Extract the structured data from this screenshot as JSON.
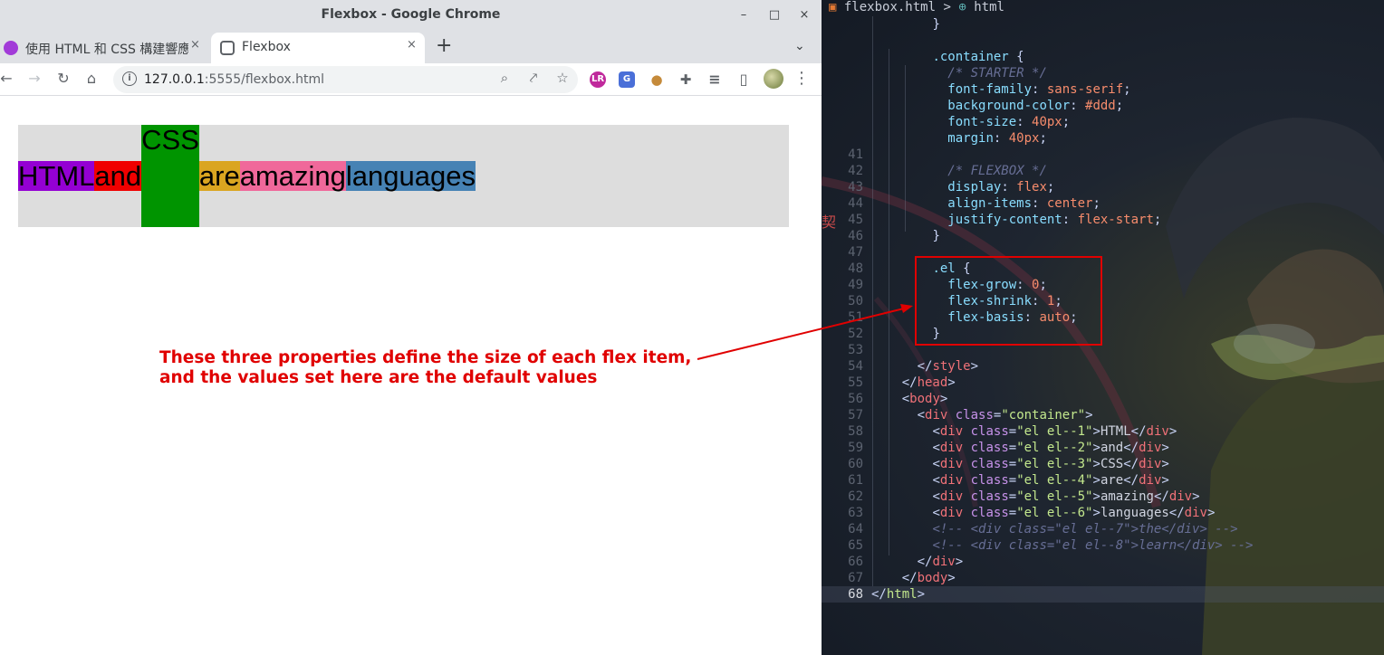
{
  "window": {
    "title": "Flexbox - Google Chrome",
    "controls": [
      "–",
      "□",
      "×"
    ]
  },
  "tabs": [
    {
      "label": "使用 HTML 和 CSS 構建響應",
      "favicon_color": "#a23bd8"
    },
    {
      "label": "Flexbox",
      "active": true
    }
  ],
  "tab_close": "×",
  "new_tab": "+",
  "tab_menu": "⌄",
  "nav": {
    "back": "←",
    "forward": "→",
    "reload": "↻",
    "home": "⌂"
  },
  "address": {
    "host": "127.0.0.1",
    "rest": ":5555/flexbox.html",
    "info": "i"
  },
  "omni_icons": {
    "zoom": "⌕",
    "share": "⤤",
    "bookmark": "☆"
  },
  "extensions": [
    {
      "name": "lr-icon",
      "glyph": "LR",
      "color": "#c0299c"
    },
    {
      "name": "translate-icon",
      "glyph": "G",
      "color": "#4a6fd8"
    },
    {
      "name": "cookie-icon",
      "glyph": "●",
      "color": "#c58a3a"
    },
    {
      "name": "puzzle-icon",
      "glyph": "✚",
      "color": "#5f6368"
    },
    {
      "name": "playlist-icon",
      "glyph": "≡",
      "color": "#5f6368"
    },
    {
      "name": "sidepanel-icon",
      "glyph": "▯",
      "color": "#5f6368"
    }
  ],
  "menu": "⋮",
  "flex_items": [
    {
      "text": "HTML",
      "color": "#9400d3"
    },
    {
      "text": "and",
      "color": "#f00000"
    },
    {
      "text": "CSS",
      "color": "#009400"
    },
    {
      "text": "are",
      "color": "#daa520"
    },
    {
      "text": "amazing",
      "color": "#f0689a"
    },
    {
      "text": "languages",
      "color": "#4682b4"
    }
  ],
  "annotation": {
    "line1": "These three properties define the size of each flex item,",
    "line2": "and the values set here are the default values",
    "color": "#e00000"
  },
  "editor": {
    "breadcrumb": {
      "file": "flexbox.html",
      "sep": ">",
      "node": "html"
    },
    "side_char": "契",
    "lines": [
      {
        "n": "",
        "segs": [
          [
            "        ",
            ""
          ],
          [
            "}",
            "t-pun"
          ]
        ]
      },
      {
        "n": "",
        "segs": []
      },
      {
        "n": "",
        "segs": [
          [
            "        ",
            ""
          ],
          [
            ".container",
            "t-sel"
          ],
          [
            " {",
            "t-pun"
          ]
        ]
      },
      {
        "n": "",
        "segs": [
          [
            "          ",
            ""
          ],
          [
            "/* STARTER */",
            "t-com"
          ]
        ]
      },
      {
        "n": "",
        "segs": [
          [
            "          ",
            ""
          ],
          [
            "font-family",
            "t-prop"
          ],
          [
            ": ",
            "t-pun"
          ],
          [
            "sans-serif",
            "t-val"
          ],
          [
            ";",
            "t-pun"
          ]
        ]
      },
      {
        "n": "",
        "segs": [
          [
            "          ",
            ""
          ],
          [
            "background-color",
            "t-prop"
          ],
          [
            ": ",
            "t-pun"
          ],
          [
            "#ddd",
            "t-val"
          ],
          [
            ";",
            "t-pun"
          ]
        ]
      },
      {
        "n": "",
        "segs": [
          [
            "          ",
            ""
          ],
          [
            "font-size",
            "t-prop"
          ],
          [
            ": ",
            "t-pun"
          ],
          [
            "40px",
            "t-val"
          ],
          [
            ";",
            "t-pun"
          ]
        ]
      },
      {
        "n": "",
        "segs": [
          [
            "          ",
            ""
          ],
          [
            "margin",
            "t-prop"
          ],
          [
            ": ",
            "t-pun"
          ],
          [
            "40px",
            "t-val"
          ],
          [
            ";",
            "t-pun"
          ]
        ]
      },
      {
        "n": "41",
        "segs": []
      },
      {
        "n": "42",
        "segs": [
          [
            "          ",
            ""
          ],
          [
            "/* FLEXBOX */",
            "t-com"
          ]
        ]
      },
      {
        "n": "43",
        "segs": [
          [
            "          ",
            ""
          ],
          [
            "display",
            "t-prop"
          ],
          [
            ": ",
            "t-pun"
          ],
          [
            "flex",
            "t-val"
          ],
          [
            ";",
            "t-pun"
          ]
        ]
      },
      {
        "n": "44",
        "segs": [
          [
            "          ",
            ""
          ],
          [
            "align-items",
            "t-prop"
          ],
          [
            ": ",
            "t-pun"
          ],
          [
            "center",
            "t-val"
          ],
          [
            ";",
            "t-pun"
          ]
        ]
      },
      {
        "n": "45",
        "segs": [
          [
            "          ",
            ""
          ],
          [
            "justify-content",
            "t-prop"
          ],
          [
            ": ",
            "t-pun"
          ],
          [
            "flex-start",
            "t-val"
          ],
          [
            ";",
            "t-pun"
          ]
        ]
      },
      {
        "n": "46",
        "segs": [
          [
            "        ",
            ""
          ],
          [
            "}",
            "t-pun"
          ]
        ]
      },
      {
        "n": "47",
        "segs": []
      },
      {
        "n": "48",
        "segs": [
          [
            "        ",
            ""
          ],
          [
            ".el",
            "t-sel"
          ],
          [
            " {",
            "t-pun"
          ]
        ]
      },
      {
        "n": "49",
        "segs": [
          [
            "          ",
            ""
          ],
          [
            "flex-grow",
            "t-prop"
          ],
          [
            ": ",
            "t-pun"
          ],
          [
            "0",
            "t-val"
          ],
          [
            ";",
            "t-pun"
          ]
        ]
      },
      {
        "n": "50",
        "segs": [
          [
            "          ",
            ""
          ],
          [
            "flex-shrink",
            "t-prop"
          ],
          [
            ": ",
            "t-pun"
          ],
          [
            "1",
            "t-val"
          ],
          [
            ";",
            "t-pun"
          ]
        ]
      },
      {
        "n": "51",
        "segs": [
          [
            "          ",
            ""
          ],
          [
            "flex-basis",
            "t-prop"
          ],
          [
            ": ",
            "t-pun"
          ],
          [
            "auto",
            "t-val"
          ],
          [
            ";",
            "t-pun"
          ]
        ]
      },
      {
        "n": "52",
        "segs": [
          [
            "        ",
            ""
          ],
          [
            "}",
            "t-pun"
          ]
        ]
      },
      {
        "n": "53",
        "segs": []
      },
      {
        "n": "54",
        "segs": [
          [
            "      ",
            ""
          ],
          [
            "</",
            "t-pun"
          ],
          [
            "style",
            "t-tag"
          ],
          [
            ">",
            "t-pun"
          ]
        ]
      },
      {
        "n": "55",
        "segs": [
          [
            "    ",
            ""
          ],
          [
            "</",
            "t-pun"
          ],
          [
            "head",
            "t-tag"
          ],
          [
            ">",
            "t-pun"
          ]
        ]
      },
      {
        "n": "56",
        "segs": [
          [
            "    ",
            ""
          ],
          [
            "<",
            "t-pun"
          ],
          [
            "body",
            "t-tag"
          ],
          [
            ">",
            "t-pun"
          ]
        ]
      },
      {
        "n": "57",
        "segs": [
          [
            "      ",
            ""
          ],
          [
            "<",
            "t-pun"
          ],
          [
            "div",
            "t-tag"
          ],
          [
            " ",
            ""
          ],
          [
            "class",
            "t-attr"
          ],
          [
            "=",
            "t-pun"
          ],
          [
            "\"container\"",
            "t-str"
          ],
          [
            ">",
            "t-pun"
          ]
        ]
      },
      {
        "n": "58",
        "segs": [
          [
            "        ",
            ""
          ],
          [
            "<",
            "t-pun"
          ],
          [
            "div",
            "t-tag"
          ],
          [
            " ",
            ""
          ],
          [
            "class",
            "t-attr"
          ],
          [
            "=",
            "t-pun"
          ],
          [
            "\"el el--1\"",
            "t-str"
          ],
          [
            ">",
            "t-pun"
          ],
          [
            "HTML",
            "t-txt"
          ],
          [
            "</",
            "t-pun"
          ],
          [
            "div",
            "t-tag"
          ],
          [
            ">",
            "t-pun"
          ]
        ]
      },
      {
        "n": "59",
        "segs": [
          [
            "        ",
            ""
          ],
          [
            "<",
            "t-pun"
          ],
          [
            "div",
            "t-tag"
          ],
          [
            " ",
            ""
          ],
          [
            "class",
            "t-attr"
          ],
          [
            "=",
            "t-pun"
          ],
          [
            "\"el el--2\"",
            "t-str"
          ],
          [
            ">",
            "t-pun"
          ],
          [
            "and",
            "t-txt"
          ],
          [
            "</",
            "t-pun"
          ],
          [
            "div",
            "t-tag"
          ],
          [
            ">",
            "t-pun"
          ]
        ]
      },
      {
        "n": "60",
        "segs": [
          [
            "        ",
            ""
          ],
          [
            "<",
            "t-pun"
          ],
          [
            "div",
            "t-tag"
          ],
          [
            " ",
            ""
          ],
          [
            "class",
            "t-attr"
          ],
          [
            "=",
            "t-pun"
          ],
          [
            "\"el el--3\"",
            "t-str"
          ],
          [
            ">",
            "t-pun"
          ],
          [
            "CSS",
            "t-txt"
          ],
          [
            "</",
            "t-pun"
          ],
          [
            "div",
            "t-tag"
          ],
          [
            ">",
            "t-pun"
          ]
        ]
      },
      {
        "n": "61",
        "segs": [
          [
            "        ",
            ""
          ],
          [
            "<",
            "t-pun"
          ],
          [
            "div",
            "t-tag"
          ],
          [
            " ",
            ""
          ],
          [
            "class",
            "t-attr"
          ],
          [
            "=",
            "t-pun"
          ],
          [
            "\"el el--4\"",
            "t-str"
          ],
          [
            ">",
            "t-pun"
          ],
          [
            "are",
            "t-txt"
          ],
          [
            "</",
            "t-pun"
          ],
          [
            "div",
            "t-tag"
          ],
          [
            ">",
            "t-pun"
          ]
        ]
      },
      {
        "n": "62",
        "segs": [
          [
            "        ",
            ""
          ],
          [
            "<",
            "t-pun"
          ],
          [
            "div",
            "t-tag"
          ],
          [
            " ",
            ""
          ],
          [
            "class",
            "t-attr"
          ],
          [
            "=",
            "t-pun"
          ],
          [
            "\"el el--5\"",
            "t-str"
          ],
          [
            ">",
            "t-pun"
          ],
          [
            "amazing",
            "t-txt"
          ],
          [
            "</",
            "t-pun"
          ],
          [
            "div",
            "t-tag"
          ],
          [
            ">",
            "t-pun"
          ]
        ]
      },
      {
        "n": "63",
        "segs": [
          [
            "        ",
            ""
          ],
          [
            "<",
            "t-pun"
          ],
          [
            "div",
            "t-tag"
          ],
          [
            " ",
            ""
          ],
          [
            "class",
            "t-attr"
          ],
          [
            "=",
            "t-pun"
          ],
          [
            "\"el el--6\"",
            "t-str"
          ],
          [
            ">",
            "t-pun"
          ],
          [
            "languages",
            "t-txt"
          ],
          [
            "</",
            "t-pun"
          ],
          [
            "div",
            "t-tag"
          ],
          [
            ">",
            "t-pun"
          ]
        ]
      },
      {
        "n": "64",
        "segs": [
          [
            "        ",
            ""
          ],
          [
            "<!-- <div class=\"el el--7\">the</div> -->",
            "t-com"
          ]
        ]
      },
      {
        "n": "65",
        "segs": [
          [
            "        ",
            ""
          ],
          [
            "<!-- <div class=\"el el--8\">learn</div> -->",
            "t-com"
          ]
        ]
      },
      {
        "n": "66",
        "segs": [
          [
            "      ",
            ""
          ],
          [
            "</",
            "t-pun"
          ],
          [
            "div",
            "t-tag"
          ],
          [
            ">",
            "t-pun"
          ]
        ]
      },
      {
        "n": "67",
        "segs": [
          [
            "    ",
            ""
          ],
          [
            "</",
            "t-pun"
          ],
          [
            "body",
            "t-tag"
          ],
          [
            ">",
            "t-pun"
          ]
        ]
      },
      {
        "n": "68",
        "cur": true,
        "segs": [
          [
            "",
            ""
          ],
          [
            "</",
            "t-pun"
          ],
          [
            "html",
            "t-tagb"
          ],
          [
            ">",
            "t-pun"
          ]
        ]
      }
    ]
  }
}
